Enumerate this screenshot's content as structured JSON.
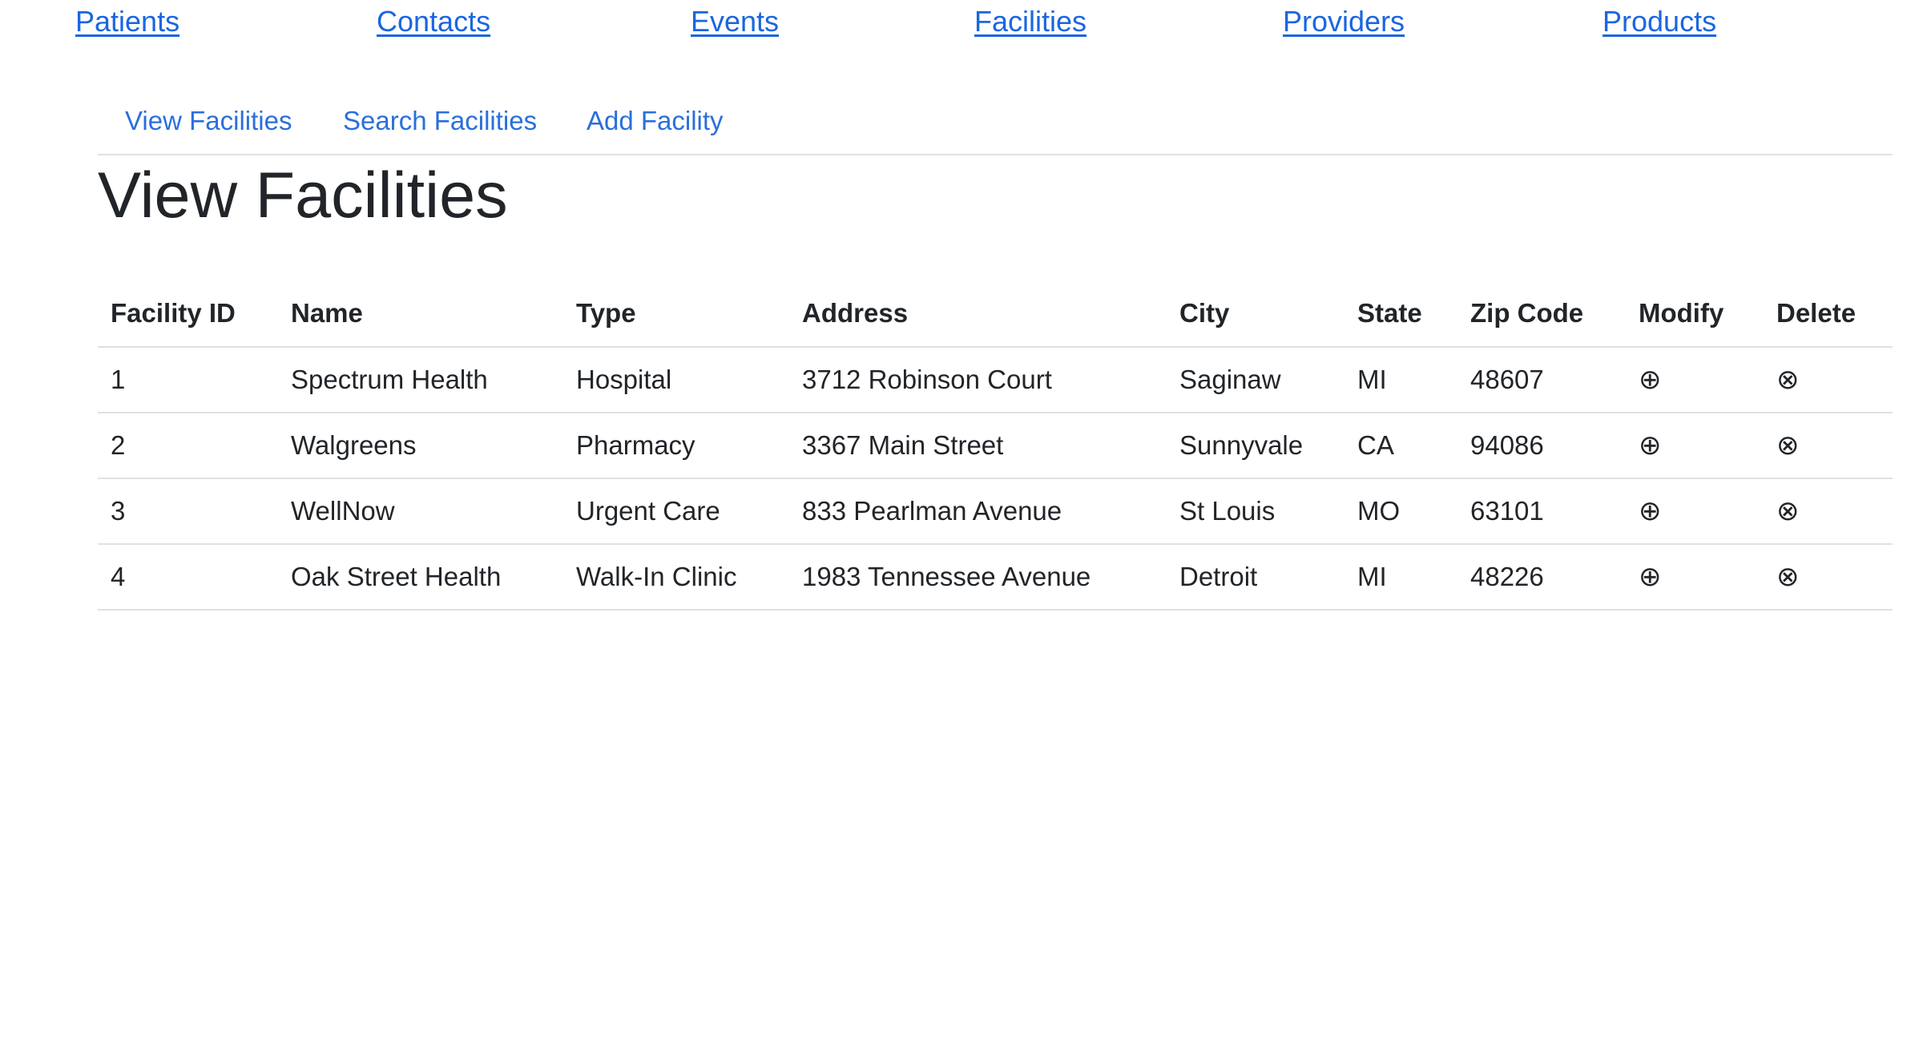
{
  "topnav": {
    "patients": "Patients",
    "contacts": "Contacts",
    "events": "Events",
    "facilities": "Facilities",
    "providers": "Providers",
    "products": "Products"
  },
  "subnav": {
    "view": "View Facilities",
    "search": "Search Facilities",
    "add": "Add Facility"
  },
  "page": {
    "title": "View Facilities"
  },
  "table": {
    "headers": [
      "Facility ID",
      "Name",
      "Type",
      "Address",
      "City",
      "State",
      "Zip Code",
      "Modify",
      "Delete"
    ],
    "rows": [
      [
        "1",
        "Spectrum Health",
        "Hospital",
        "3712 Robinson Court",
        "Saginaw",
        "MI",
        "48607",
        "⊕",
        "⊗"
      ],
      [
        "2",
        "Walgreens",
        "Pharmacy",
        "3367 Main Street",
        "Sunnyvale",
        "CA",
        "94086",
        "⊕",
        "⊗"
      ],
      [
        "3",
        "WellNow",
        "Urgent Care",
        "833 Pearlman Avenue",
        "St Louis",
        "MO",
        "63101",
        "⊕",
        "⊗"
      ],
      [
        "4",
        "Oak Street Health",
        "Walk-In Clinic",
        "1983 Tennessee Avenue",
        "Detroit",
        "MI",
        "48226",
        "⊕",
        "⊗"
      ]
    ]
  },
  "icons": {
    "modify": "circled-plus-icon",
    "delete": "circled-times-icon"
  },
  "colors": {
    "link": "#1a66e0",
    "subnav_link": "#2a6fdb",
    "text": "#212529",
    "border": "#dee2e6"
  }
}
